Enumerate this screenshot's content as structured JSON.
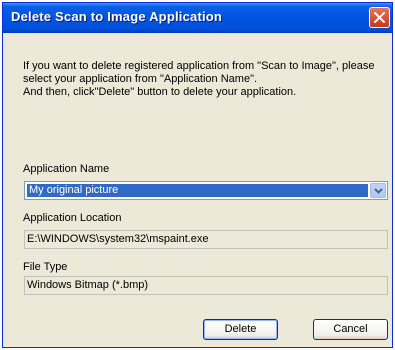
{
  "dialog": {
    "title": "Delete Scan to Image Application"
  },
  "intro": {
    "line1": "If you want to delete registered application from \"Scan to Image\", please",
    "line2": "select your application from \"Application Name\".",
    "line3": "And then, click\"Delete\" button to delete your application."
  },
  "app_name": {
    "label": "Application Name",
    "selected": "My original picture"
  },
  "app_location": {
    "label": "Application Location",
    "value": "E:\\WINDOWS\\system32\\mspaint.exe"
  },
  "file_type": {
    "label": "File Type",
    "value": "Windows Bitmap (*.bmp)"
  },
  "buttons": {
    "delete": "Delete",
    "cancel": "Cancel"
  }
}
